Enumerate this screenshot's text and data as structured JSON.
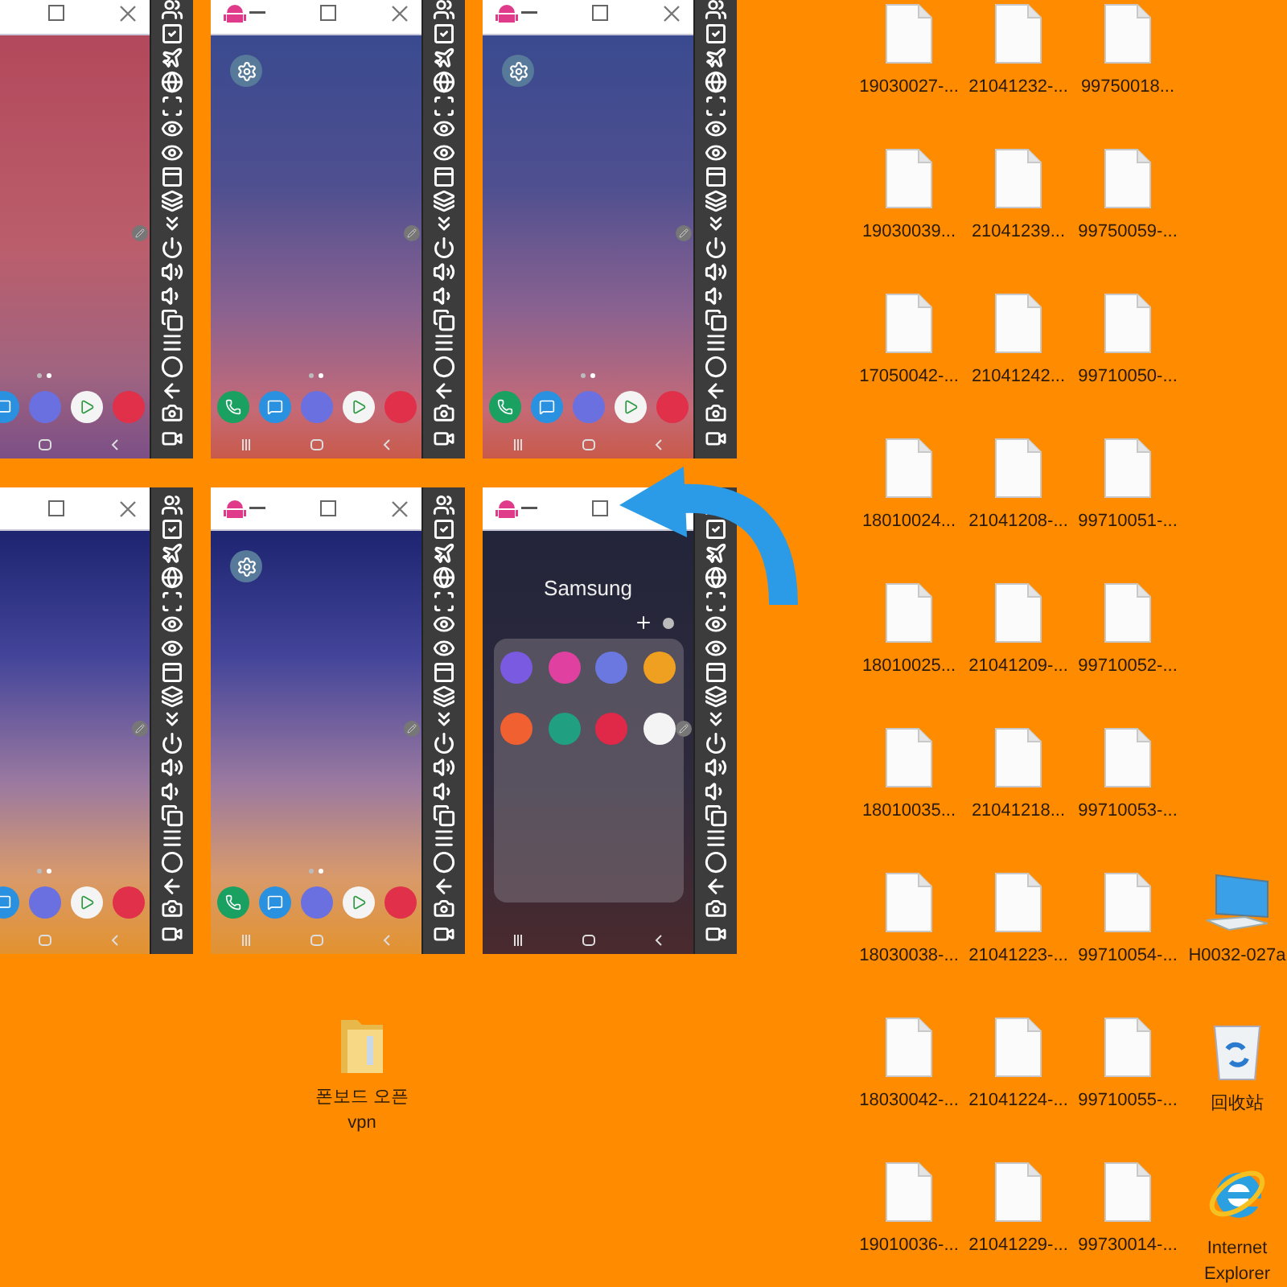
{
  "desktop": {
    "phone_windows": [
      {
        "kind": "rose"
      },
      {
        "kind": "dusk"
      },
      {
        "kind": "dusk"
      },
      {
        "kind": "sunset"
      },
      {
        "kind": "sunset"
      },
      {
        "kind": "folder",
        "folder_title": "Samsung"
      }
    ],
    "file_columns": [
      [
        "19030027-...",
        "19030039...",
        "17050042-...",
        "18010024...",
        "18010025...",
        "18010035...",
        "18030038-...",
        "18030042-...",
        "19010036-..."
      ],
      [
        "21041232-...",
        "21041239...",
        "21041242...",
        "21041208-...",
        "21041209-...",
        "21041218...",
        "21041223-...",
        "21041224-...",
        "21041229-..."
      ],
      [
        "99750018...",
        "99750059-...",
        "99710050-...",
        "99710051-...",
        "99710052-...",
        "99710053-...",
        "99710054-...",
        "99710055-...",
        "99730014-..."
      ]
    ],
    "system_icons": [
      {
        "kind": "computer",
        "label": "H0032-027a"
      },
      {
        "kind": "recycle-bin",
        "label": "回收站"
      },
      {
        "kind": "browser",
        "label": "Internet Explorer"
      }
    ],
    "folder_icon": {
      "label": "폰보드 오픈 vpn"
    }
  }
}
